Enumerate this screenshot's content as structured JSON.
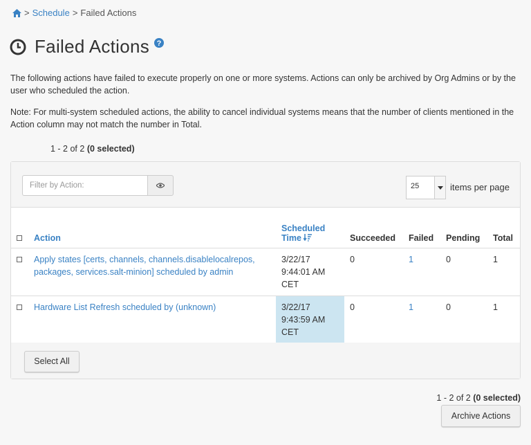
{
  "breadcrumb": {
    "home_icon": "home-icon",
    "sep1": ">",
    "schedule": "Schedule",
    "sep2": ">",
    "current": "Failed Actions"
  },
  "page": {
    "title": "Failed Actions",
    "title_icon": "clock-icon",
    "help_icon": "question-circle-icon",
    "desc1": "The following actions have failed to execute properly on one or more systems. Actions can only be archived by Org Admins or by the user who scheduled the action.",
    "desc2": "Note: For multi-system scheduled actions, the ability to cancel individual systems means that the number of clients mentioned in the Action column may not match the number in Total."
  },
  "pagination": {
    "range": "1 - 2 of 2",
    "selected": "(0 selected)"
  },
  "filter": {
    "placeholder": "Filter by Action:",
    "button_icon": "eye-icon"
  },
  "per_page": {
    "value": "25",
    "label": "items per page"
  },
  "table": {
    "headers": {
      "action": "Action",
      "scheduled_time_1": "Scheduled",
      "scheduled_time_2": "Time",
      "succeeded": "Succeeded",
      "failed": "Failed",
      "pending": "Pending",
      "total": "Total"
    },
    "rows": [
      {
        "action": "Apply states [certs, channels, channels.disablelocalrepos, packages, services.salt-minion] scheduled by admin",
        "time_1": "3/22/17",
        "time_2": "9:44:01 AM",
        "time_3": "CET",
        "succeeded": "0",
        "failed": "1",
        "pending": "0",
        "total": "1"
      },
      {
        "action": "Hardware List Refresh scheduled by (unknown)",
        "time_1": "3/22/17",
        "time_2": "9:43:59 AM",
        "time_3": "CET",
        "succeeded": "0",
        "failed": "1",
        "pending": "0",
        "total": "1"
      }
    ]
  },
  "buttons": {
    "select_all": "Select All",
    "archive": "Archive Actions"
  },
  "colors": {
    "link": "#3a82c4",
    "highlight": "#cce5f1"
  }
}
